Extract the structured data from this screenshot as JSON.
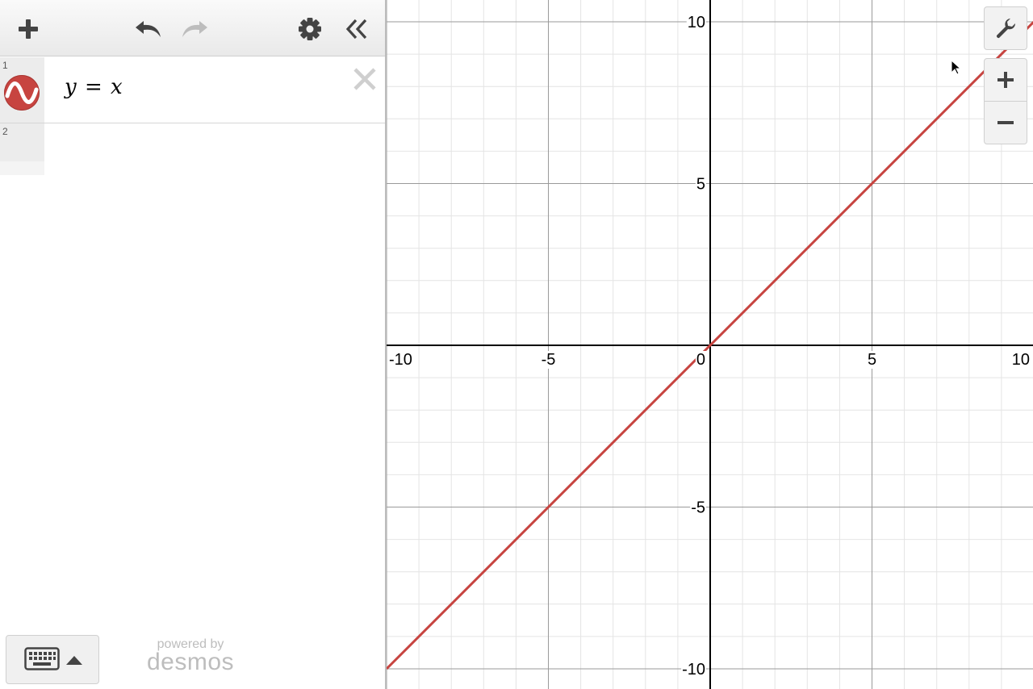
{
  "toolbar": {
    "add": "plus-icon",
    "undo": "undo-icon",
    "redo": "redo-icon",
    "settings": "gear-icon",
    "collapse": "double-chevron-left-icon"
  },
  "expressions": [
    {
      "index": "1",
      "latex": "y = x",
      "color": "#c74440"
    },
    {
      "index": "2",
      "latex": ""
    }
  ],
  "keyboard": {
    "icon": "keyboard-icon",
    "caret": "caret-up-icon"
  },
  "branding": {
    "line1": "powered by",
    "line2": "desmos"
  },
  "graph_controls": {
    "settings": "wrench-icon",
    "zoom_in": "plus-icon",
    "zoom_out": "minus-icon"
  },
  "graph": {
    "x_ticks": [
      "-10",
      "-5",
      "0",
      "5",
      "10"
    ],
    "y_ticks": [
      "10",
      "5",
      "-5",
      "-10"
    ],
    "xlim": [
      -10,
      10
    ],
    "ylim": [
      -10,
      10
    ],
    "grid": true
  },
  "chart_data": {
    "type": "line",
    "series": [
      {
        "x": [
          -10,
          10
        ],
        "y": [
          -10,
          10
        ],
        "color": "#c74440"
      }
    ],
    "xlim": [
      -10,
      10
    ],
    "ylim": [
      -10,
      10
    ]
  }
}
